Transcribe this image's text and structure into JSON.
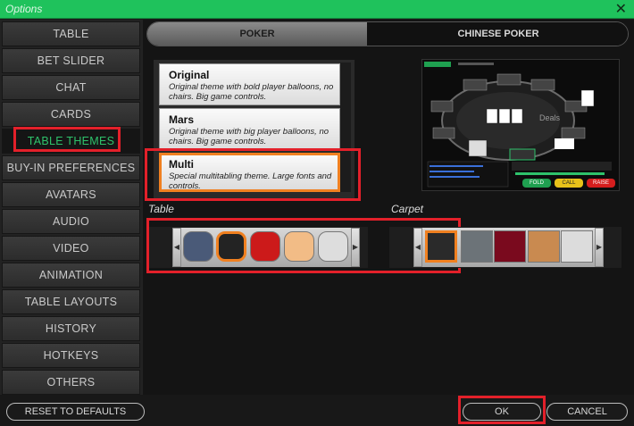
{
  "window": {
    "title": "Options"
  },
  "sidebar": {
    "items": [
      {
        "label": "TABLE"
      },
      {
        "label": "BET SLIDER"
      },
      {
        "label": "CHAT"
      },
      {
        "label": "CARDS"
      },
      {
        "label": "TABLE THEMES",
        "active": true
      },
      {
        "label": "BUY-IN PREFERENCES"
      },
      {
        "label": "AVATARS"
      },
      {
        "label": "AUDIO"
      },
      {
        "label": "VIDEO"
      },
      {
        "label": "ANIMATION"
      },
      {
        "label": "TABLE LAYOUTS"
      },
      {
        "label": "HISTORY"
      },
      {
        "label": "HOTKEYS"
      },
      {
        "label": "OTHERS"
      }
    ]
  },
  "tabs": [
    {
      "label": "POKER",
      "active": true
    },
    {
      "label": "CHINESE POKER",
      "active": false
    }
  ],
  "themes": [
    {
      "name": "Original",
      "description": "Original theme with bold player balloons, no chairs. Big game controls."
    },
    {
      "name": "Mars",
      "description": "Original theme with big player balloons, no chairs. Big game controls."
    },
    {
      "name": "Multi",
      "description": "Special multitabling theme. Large fonts and controls.",
      "selected": true
    }
  ],
  "preview": {
    "dealer_text": "Deals",
    "buttons": [
      "FOLD",
      "CALL",
      "RAISE"
    ]
  },
  "table_section": {
    "label": "Table",
    "swatches": [
      "#4a5a78",
      "#232323",
      "#cc1a1a",
      "#f2bc86",
      "#dddddd"
    ],
    "selected_index": 1
  },
  "carpet_section": {
    "label": "Carpet",
    "swatches": [
      "#2a2a2a",
      "#6c7378",
      "#7a0a1e",
      "#c98a50",
      "#dcdcdc"
    ],
    "selected_index": 0
  },
  "footer": {
    "reset_label": "RESET TO DEFAULTS",
    "ok_label": "OK",
    "cancel_label": "CANCEL"
  },
  "colors": {
    "title_bar": "#1fc25c",
    "active_item": "#2ec26b",
    "highlight": "#e3202a",
    "selected_outline": "#f08020"
  }
}
